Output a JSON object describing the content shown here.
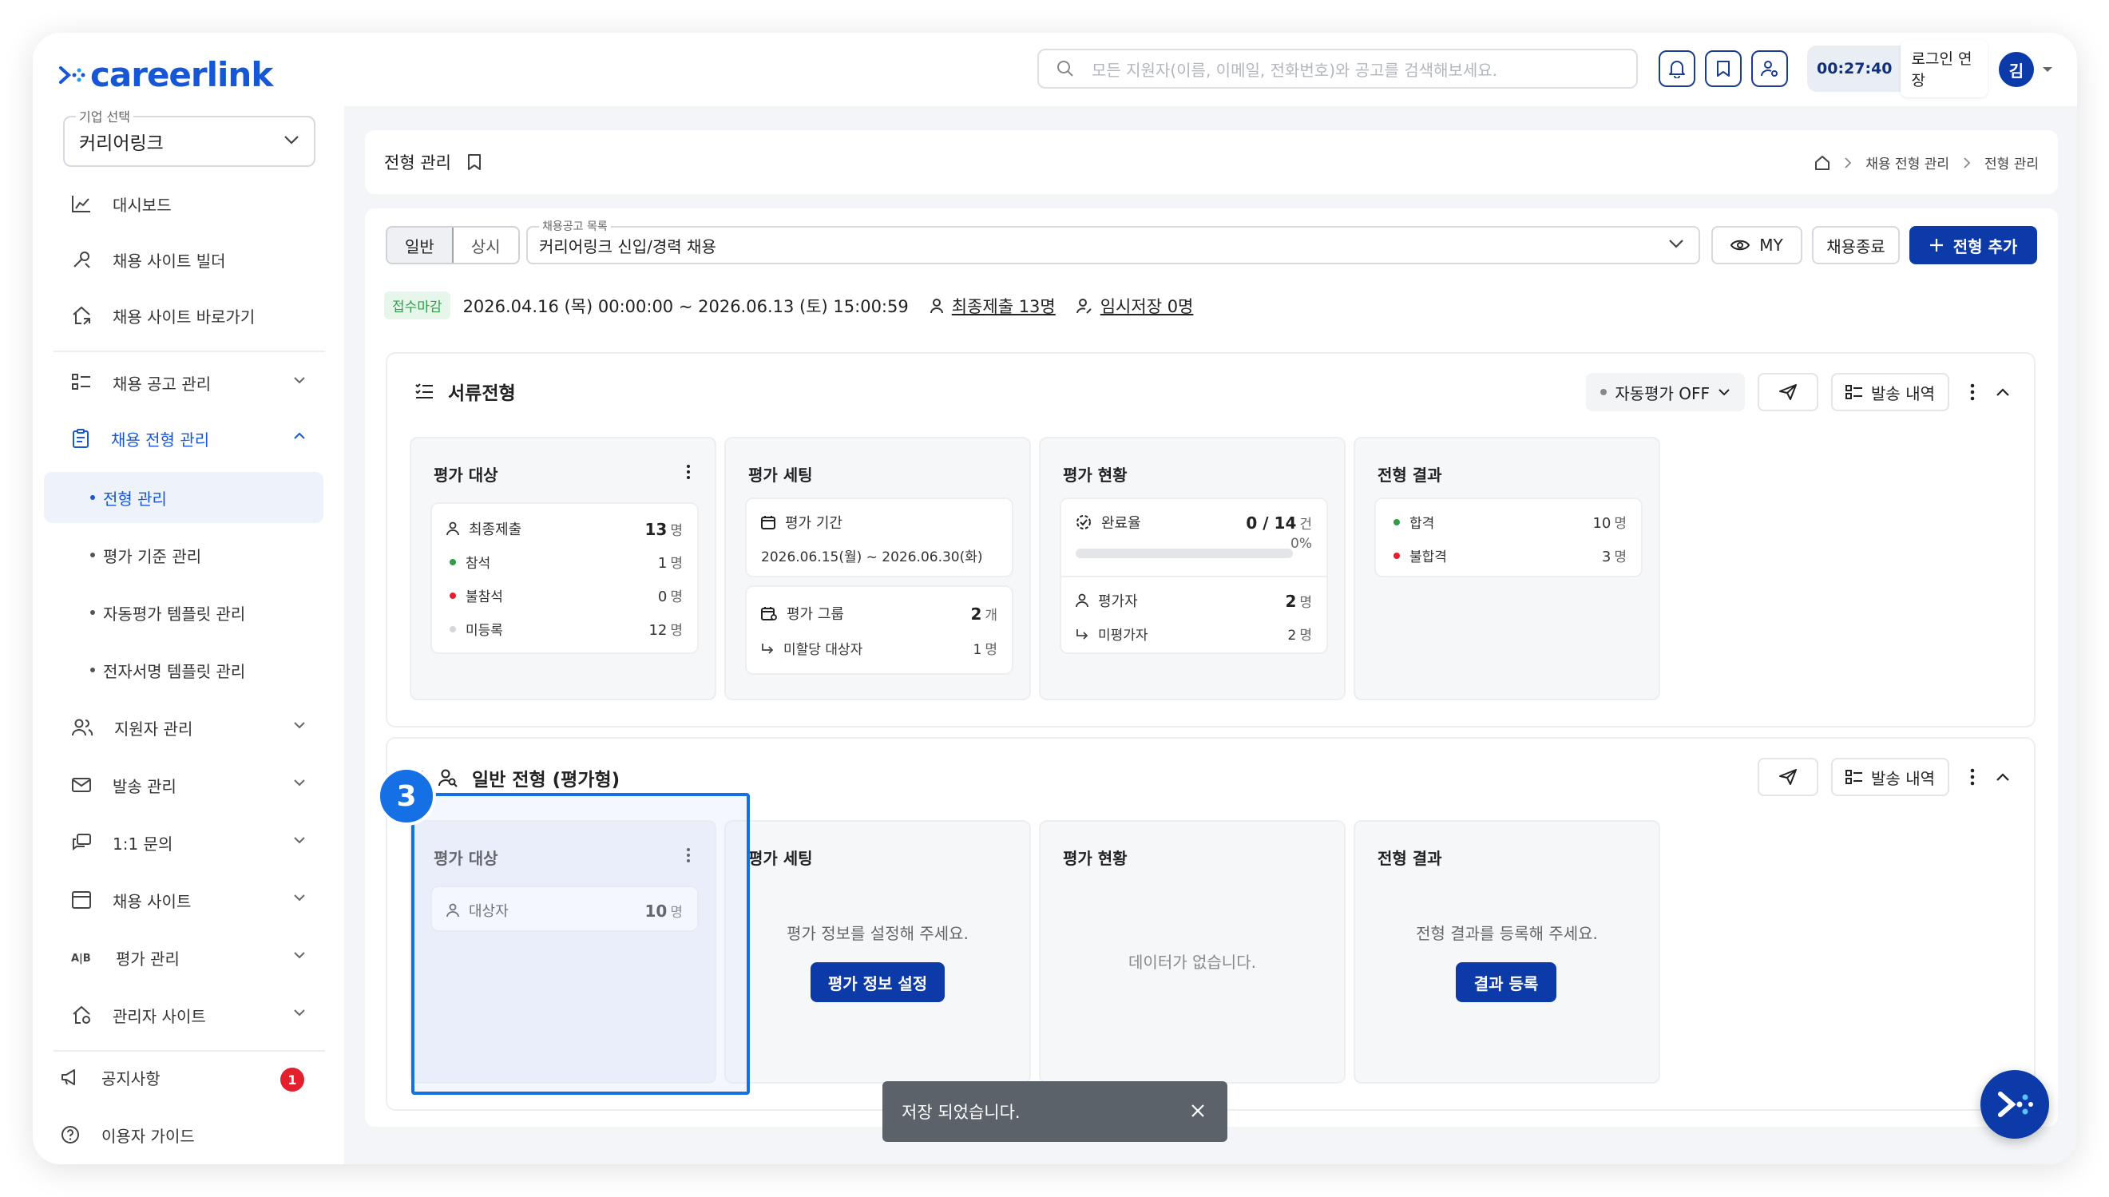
{
  "app": {
    "logo_text": "careerlink",
    "search_placeholder": "모든 지원자(이름, 이메일, 전화번호)와 공고를 검색해보세요.",
    "timer": "00:27:40",
    "extend_label": "로그인 연장",
    "avatar_initial": "김",
    "brand_color": "#1657d6",
    "primary_color": "#0c3aa8"
  },
  "sidebar": {
    "company_label": "기업 선택",
    "company_value": "커리어링크",
    "items": [
      {
        "label": "대시보드"
      },
      {
        "label": "채용 사이트 빌더"
      },
      {
        "label": "채용 사이트 바로가기"
      },
      {
        "label": "채용 공고 관리"
      },
      {
        "label": "채용 전형 관리"
      },
      {
        "label": "지원자 관리"
      },
      {
        "label": "발송 관리"
      },
      {
        "label": "1:1 문의"
      },
      {
        "label": "채용 사이트"
      },
      {
        "label": "평가 관리"
      },
      {
        "label": "관리자 사이트"
      }
    ],
    "sub_items": [
      {
        "label": "전형 관리"
      },
      {
        "label": "평가 기준 관리"
      },
      {
        "label": "자동평가 템플릿 관리"
      },
      {
        "label": "전자서명 템플릿 관리"
      }
    ],
    "notice_label": "공지사항",
    "notice_badge": "1",
    "guide_label": "이용자 가이드"
  },
  "header": {
    "title": "전형 관리",
    "breadcrumbs": [
      "채용 전형 관리",
      "전형 관리"
    ]
  },
  "toolbar": {
    "tabs": [
      "일반",
      "상시"
    ],
    "posting_label": "채용공고 목록",
    "posting_value": "커리어링크 신입/경력 채용",
    "my_label": "MY",
    "close_label": "채용종료",
    "add_label": "전형 추가"
  },
  "info": {
    "status": "접수마감",
    "period": "2026.04.16 (목) 00:00:00 ~ 2026.06.13 (토) 15:00:59",
    "final_submit": "최종제출 13명",
    "temp_save": "임시저장 0명"
  },
  "stage1": {
    "title": "서류전형",
    "auto_eval": "자동평가 OFF",
    "history_label": "발송 내역",
    "target": {
      "title": "평가 대상",
      "rows": [
        {
          "label": "최종제출",
          "value": "13",
          "unit": "명"
        },
        {
          "label": "참석",
          "value": "1",
          "unit": "명"
        },
        {
          "label": "불참석",
          "value": "0",
          "unit": "명"
        },
        {
          "label": "미등록",
          "value": "12",
          "unit": "명"
        }
      ]
    },
    "setting": {
      "title": "평가 세팅",
      "period_label": "평가 기간",
      "period_value": "2026.06.15(월) ~ 2026.06.30(화)",
      "group_label": "평가 그룹",
      "group_value": "2",
      "group_unit": "개",
      "unassigned_label": "미할당 대상자",
      "unassigned_value": "1",
      "unassigned_unit": "명"
    },
    "status": {
      "title": "평가 현황",
      "rate_label": "완료율",
      "rate_value": "0 / 14",
      "rate_unit": "건",
      "rate_percent": "0%",
      "rate_fraction": 0,
      "evaluator_label": "평가자",
      "evaluator_value": "2",
      "evaluator_unit": "명",
      "not_evaluated_label": "미평가자",
      "not_evaluated_value": "2",
      "not_evaluated_unit": "명"
    },
    "result": {
      "title": "전형 결과",
      "pass_label": "합격",
      "pass_value": "10",
      "pass_unit": "명",
      "fail_label": "불합격",
      "fail_value": "3",
      "fail_unit": "명"
    }
  },
  "stage2": {
    "title": "일반 전형 (평가형)",
    "history_label": "발송 내역",
    "step_number": "3",
    "target": {
      "title": "평가 대상",
      "row_label": "대상자",
      "row_value": "10",
      "row_unit": "명"
    },
    "setting": {
      "title": "평가 세팅",
      "message": "평가 정보를 설정해 주세요.",
      "button": "평가 정보 설정"
    },
    "status": {
      "title": "평가 현황",
      "message": "데이터가 없습니다."
    },
    "result": {
      "title": "전형 결과",
      "message": "전형 결과를 등록해 주세요.",
      "button": "결과 등록"
    }
  },
  "toast": {
    "message": "저장 되었습니다."
  }
}
